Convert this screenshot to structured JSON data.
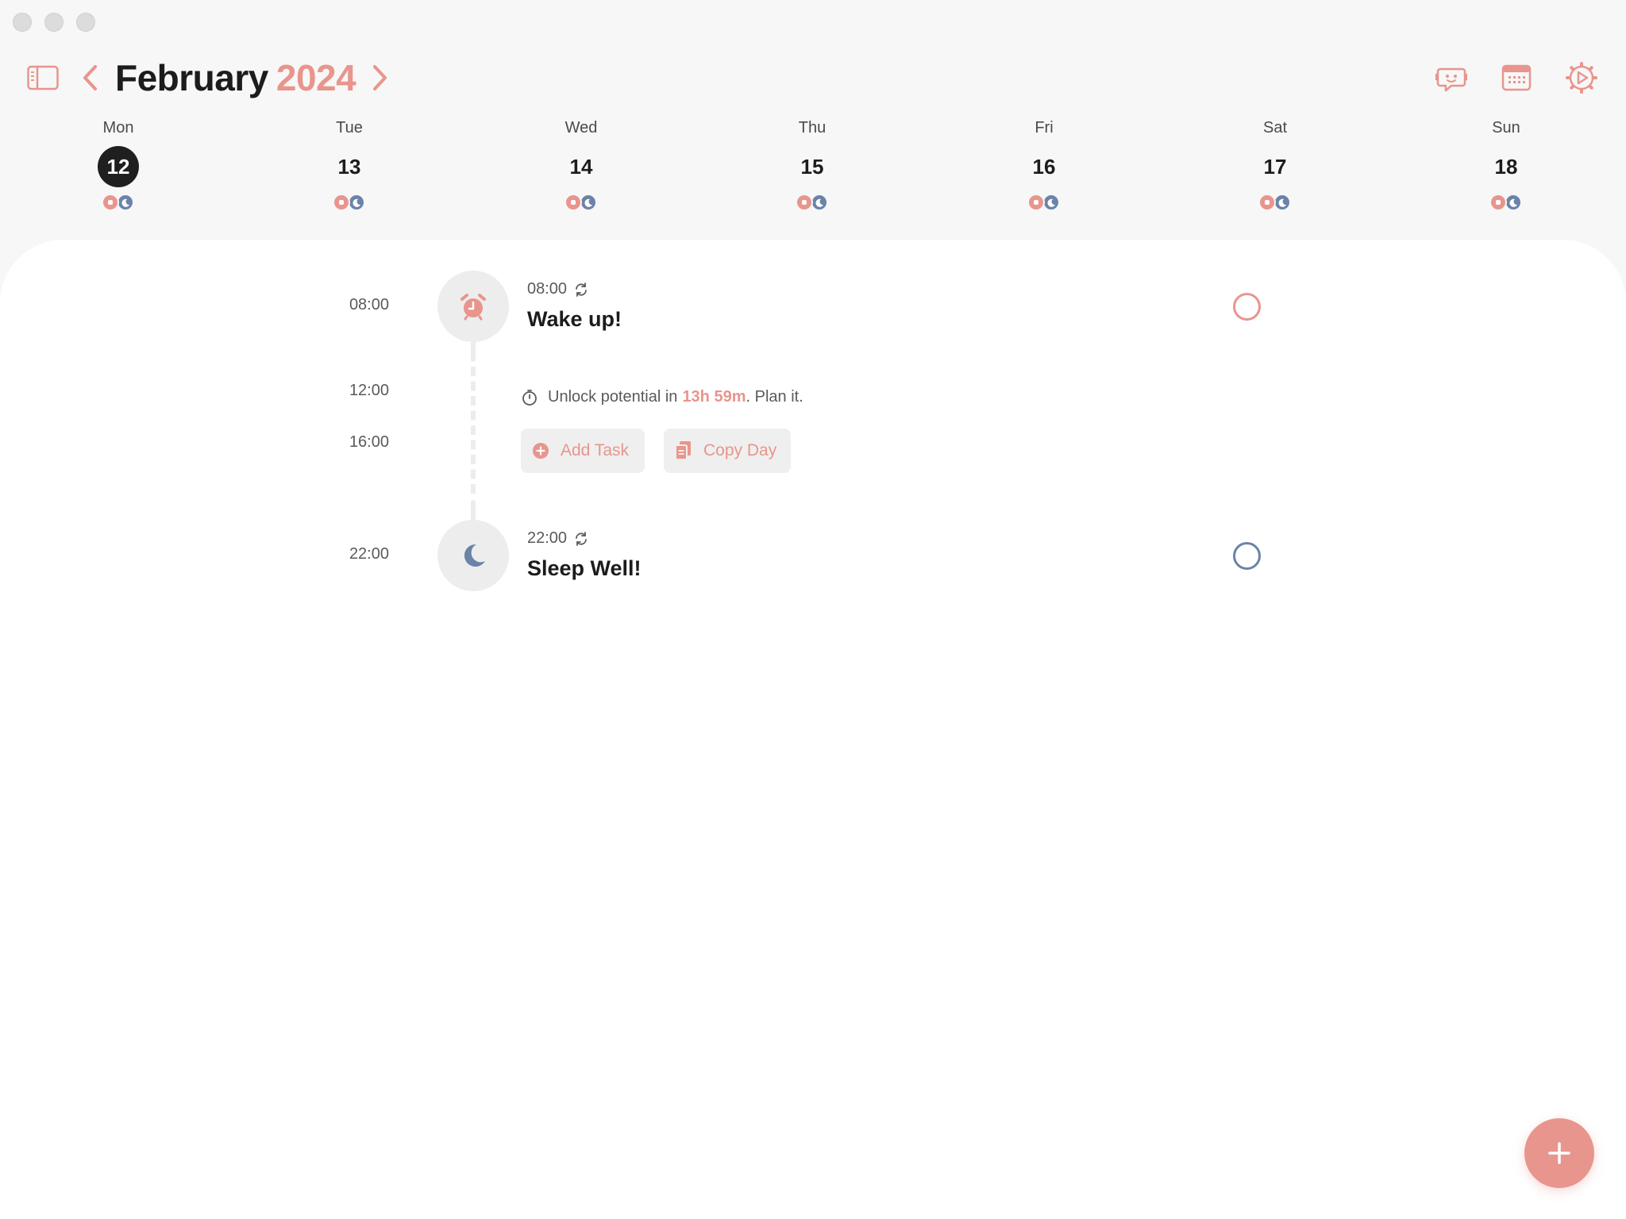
{
  "header": {
    "month": "February",
    "year": "2024"
  },
  "week": [
    {
      "name": "Mon",
      "num": "12",
      "selected": true
    },
    {
      "name": "Tue",
      "num": "13",
      "selected": false
    },
    {
      "name": "Wed",
      "num": "14",
      "selected": false
    },
    {
      "name": "Thu",
      "num": "15",
      "selected": false
    },
    {
      "name": "Fri",
      "num": "16",
      "selected": false
    },
    {
      "name": "Sat",
      "num": "17",
      "selected": false
    },
    {
      "name": "Sun",
      "num": "18",
      "selected": false
    }
  ],
  "timeline": {
    "labels": [
      "08:00",
      "12:00",
      "16:00",
      "22:00"
    ]
  },
  "tasks": {
    "wake": {
      "time": "08:00",
      "title": "Wake up!"
    },
    "sleep": {
      "time": "22:00",
      "title": "Sleep Well!"
    }
  },
  "hint": {
    "prefix": "Unlock potential in",
    "duration": "13h 59m",
    "suffix": ". Plan it."
  },
  "actions": {
    "add_task": "Add Task",
    "copy_day": "Copy Day"
  },
  "colors": {
    "accent": "#e8958d",
    "sleep": "#6b83a8",
    "selected_day_bg": "#1f1f1f"
  }
}
